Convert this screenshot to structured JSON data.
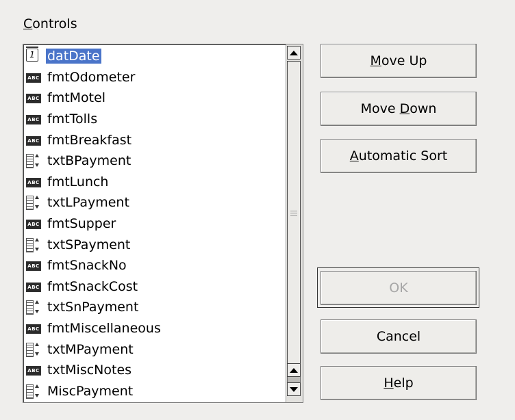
{
  "group_label": {
    "prefix": "C",
    "rest": "ontrols"
  },
  "controls": [
    {
      "label": "datDate",
      "type": "date",
      "selected": true
    },
    {
      "label": "fmtOdometer",
      "type": "formatted"
    },
    {
      "label": "fmtMotel",
      "type": "formatted"
    },
    {
      "label": "fmtTolls",
      "type": "formatted"
    },
    {
      "label": "fmtBreakfast",
      "type": "formatted"
    },
    {
      "label": "txtBPayment",
      "type": "numeric"
    },
    {
      "label": "fmtLunch",
      "type": "formatted"
    },
    {
      "label": "txtLPayment",
      "type": "numeric"
    },
    {
      "label": "fmtSupper",
      "type": "formatted"
    },
    {
      "label": "txtSPayment",
      "type": "numeric"
    },
    {
      "label": "fmtSnackNo",
      "type": "formatted"
    },
    {
      "label": "fmtSnackCost",
      "type": "formatted"
    },
    {
      "label": "txtSnPayment",
      "type": "numeric"
    },
    {
      "label": "fmtMiscellaneous",
      "type": "formatted"
    },
    {
      "label": "txtMPayment",
      "type": "numeric"
    },
    {
      "label": "txtMiscNotes",
      "type": "formatted"
    },
    {
      "label": "MiscPayment",
      "type": "numeric"
    }
  ],
  "icons": {
    "date": "calendar-icon",
    "formatted": "abc-field-icon",
    "numeric": "numeric-field-icon"
  },
  "buttons": {
    "move_up": {
      "mnemonic": "M",
      "rest": "ove Up"
    },
    "move_down": {
      "prefix": "Move ",
      "mnemonic": "D",
      "rest": "own"
    },
    "automatic_sort": {
      "mnemonic": "A",
      "rest": "utomatic Sort"
    },
    "ok": {
      "label": "OK",
      "enabled": false
    },
    "cancel": {
      "label": "Cancel"
    },
    "help": {
      "mnemonic": "H",
      "rest": "elp"
    }
  },
  "colors": {
    "selection": "#4a74c9",
    "background": "#efeeec"
  }
}
